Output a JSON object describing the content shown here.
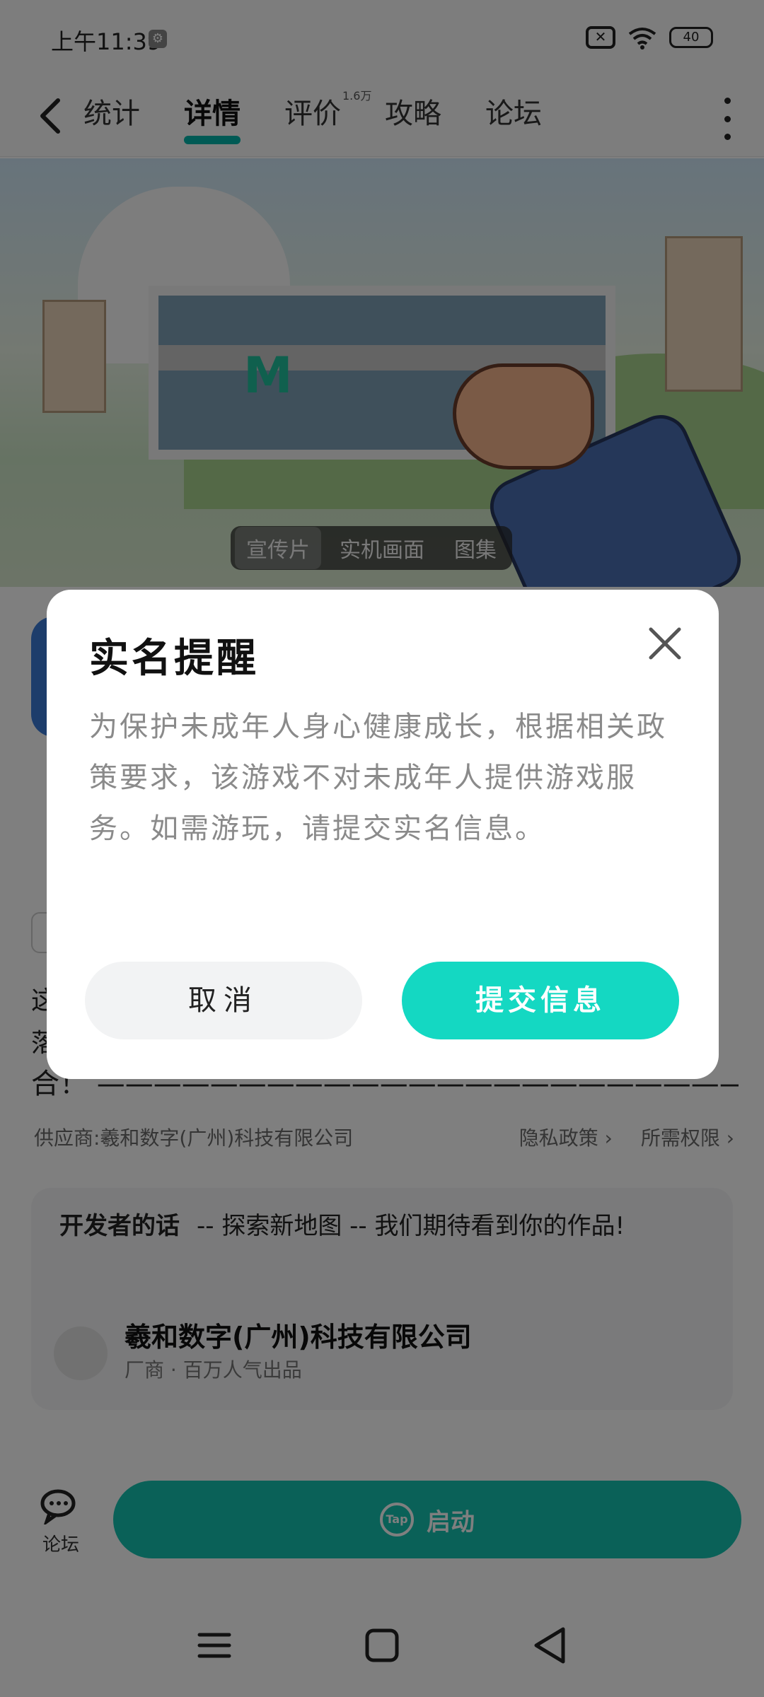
{
  "status_bar": {
    "time": "上午11:39",
    "battery": "40"
  },
  "nav": {
    "tabs": [
      {
        "label": "统计"
      },
      {
        "label": "详情"
      },
      {
        "label": "评价",
        "badge": "1.6万"
      },
      {
        "label": "攻略"
      },
      {
        "label": "论坛"
      }
    ],
    "active_tab": "详情"
  },
  "banner": {
    "media_tabs": [
      "宣传片",
      "实机画面",
      "图集"
    ],
    "active_media_tab": "宣传片"
  },
  "intro": {
    "line1": "这",
    "line2": "落",
    "tail": "合！ ——————————————————————————————…"
  },
  "meta": {
    "supplier": "供应商:羲和数字(广州)科技有限公司",
    "privacy": "隐私政策",
    "permissions": "所需权限"
  },
  "developer": {
    "heading": "开发者的话",
    "message": "-- 探索新地图 -- 我们期待看到你的作品!",
    "name": "羲和数字(广州)科技有限公司",
    "subtitle": "厂商 · 百万人气出品"
  },
  "bottom_bar": {
    "forum_label": "论坛",
    "launch_label": "启动",
    "tap_logo": "Tap"
  },
  "dialog": {
    "title": "实名提醒",
    "body": "为保护未成年人身心健康成长，根据相关政策要求，该游戏不对未成年人提供游戏服务。如需游玩，请提交实名信息。",
    "cancel_label": "取消",
    "submit_label": "提交信息"
  },
  "colors": {
    "accent": "#14c3b0",
    "submit_button": "#14d8c2",
    "scrim": "rgba(0,0,0,0.5)"
  }
}
